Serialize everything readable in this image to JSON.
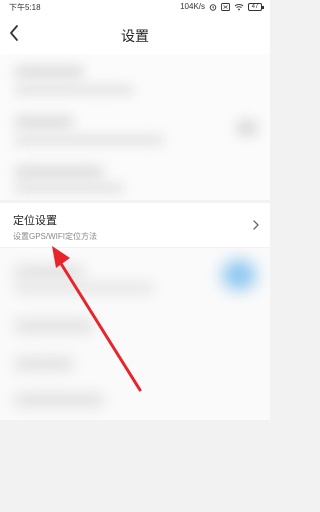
{
  "status_bar": {
    "time": "下午5:18",
    "speed": "104K/s",
    "battery": "47",
    "icons": [
      "alarm-icon",
      "sim-icon",
      "wifi-icon",
      "battery-icon"
    ]
  },
  "header": {
    "title": "设置",
    "back_icon": "back-arrow-icon"
  },
  "location_item": {
    "title": "定位设置",
    "subtitle": "设置GPS/WIFI定位方法",
    "chevron_icon": "chevron-right-icon"
  },
  "colors": {
    "annotation_arrow": "#e8232a",
    "toggle_accent": "#8cc7f0"
  }
}
